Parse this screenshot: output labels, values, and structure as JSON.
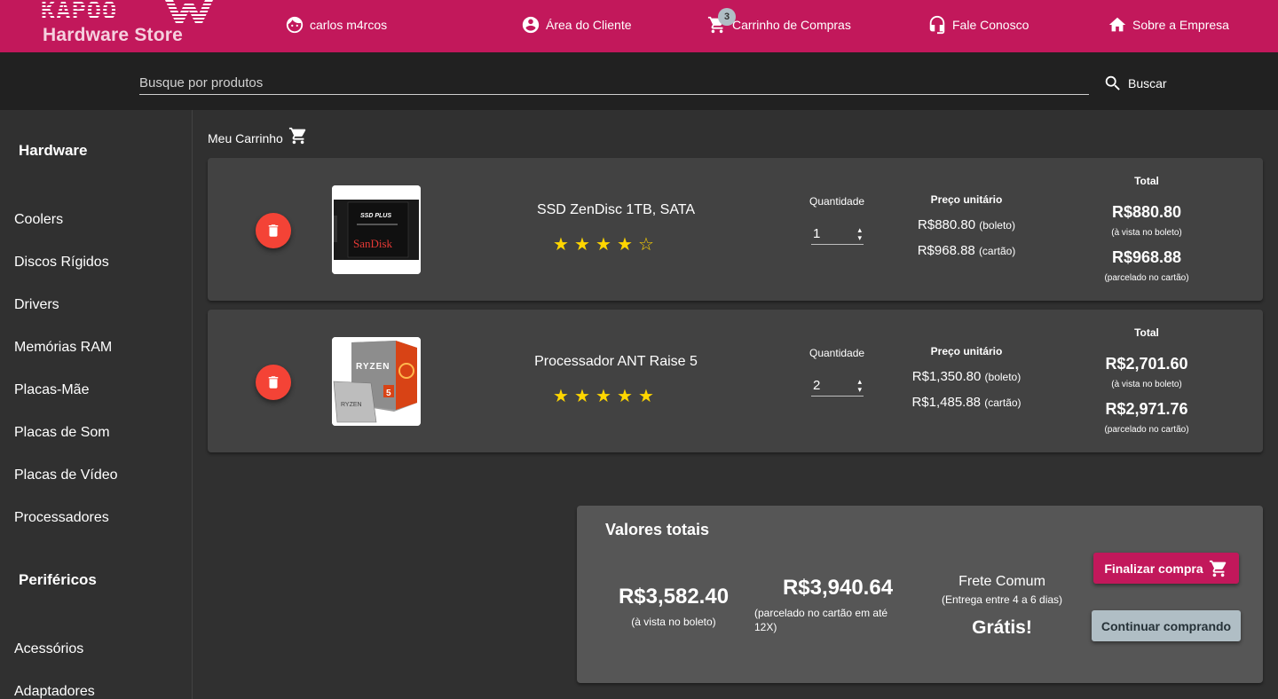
{
  "header": {
    "logo_top": "KAPOO",
    "logo_bottom": "Hardware Store",
    "user": "carlos m4rcos",
    "client_area": "Área do Cliente",
    "cart": "Carrinho de Compras",
    "cart_count": "3",
    "contact": "Fale Conosco",
    "about": "Sobre a Empresa",
    "brand_color": "#c2185b"
  },
  "search": {
    "placeholder": "Busque por produtos",
    "button_label": "Buscar"
  },
  "sidebar": {
    "hardware_heading": "Hardware",
    "hardware_items": [
      "Coolers",
      "Discos Rígidos",
      "Drivers",
      "Memórias RAM",
      "Placas-Mãe",
      "Placas de Som",
      "Placas de Vídeo",
      "Processadores"
    ],
    "perifericos_heading": "Periféricos",
    "perifericos_items": [
      "Acessórios",
      "Adaptadores"
    ]
  },
  "cart_title": "Meu Carrinho",
  "items": [
    {
      "name": "SSD ZenDisc 1TB, SATA",
      "rating": 4,
      "rating_max": 5,
      "qty_label": "Quantidade",
      "qty": "1",
      "unit_label": "Preço unitário",
      "unit_boleto": "R$880.80",
      "unit_boleto_note": "(boleto)",
      "unit_cartao": "R$968.88",
      "unit_cartao_note": "(cartão)",
      "total_label": "Total",
      "total_boleto": "R$880.80",
      "total_boleto_note": "(à vista no boleto)",
      "total_cartao": "R$968.88",
      "total_cartao_note": "(parcelado no cartão)",
      "image_icon": "ssd-sandisk-image",
      "image_text_1": "SSD PLUS",
      "image_text_2": "SanDisk"
    },
    {
      "name": "Processador ANT Raise 5",
      "rating": 5,
      "rating_max": 5,
      "qty_label": "Quantidade",
      "qty": "2",
      "unit_label": "Preço unitário",
      "unit_boleto": "R$1,350.80",
      "unit_boleto_note": "(boleto)",
      "unit_cartao": "R$1,485.88",
      "unit_cartao_note": "(cartão)",
      "total_label": "Total",
      "total_boleto": "R$2,701.60",
      "total_boleto_note": "(à vista no boleto)",
      "total_cartao": "R$2,971.76",
      "total_cartao_note": "(parcelado no cartão)",
      "image_icon": "ryzen-cpu-image",
      "image_text_1": "RYZEN",
      "image_text_2": "5"
    }
  ],
  "summary": {
    "title": "Valores totais",
    "boleto_total": "R$3,582.40",
    "boleto_note": "(à vista no boleto)",
    "cartao_total": "R$3,940.64",
    "cartao_note": "(parcelado no cartão em até 12X)",
    "frete_title": "Frete Comum",
    "frete_sub": "(Entrega entre 4 a 6 dias)",
    "frete_value": "Grátis!",
    "finalize_label": "Finalizar compra",
    "continue_label": "Continuar comprando"
  }
}
